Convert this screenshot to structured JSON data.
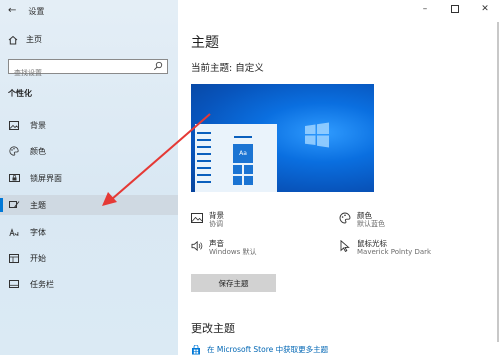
{
  "window": {
    "title": "设置"
  },
  "sidebar": {
    "home_label": "主页",
    "search_placeholder": "查找设置",
    "section_label": "个性化",
    "items": [
      {
        "label": "背景",
        "icon": "image-icon"
      },
      {
        "label": "颜色",
        "icon": "palette-icon"
      },
      {
        "label": "锁屏界面",
        "icon": "lock-screen-icon"
      },
      {
        "label": "主题",
        "icon": "theme-brush-icon",
        "active": true
      },
      {
        "label": "字体",
        "icon": "font-icon"
      },
      {
        "label": "开始",
        "icon": "start-icon"
      },
      {
        "label": "任务栏",
        "icon": "taskbar-icon"
      }
    ]
  },
  "main": {
    "title": "主题",
    "current_theme": "当前主题: 自定义",
    "preview_sample": "Aa",
    "options": [
      {
        "title": "背景",
        "subtitle": "协调",
        "icon": "background-image-icon"
      },
      {
        "title": "颜色",
        "subtitle": "默认蓝色",
        "icon": "color-palette-icon"
      },
      {
        "title": "声音",
        "subtitle": "Windows 默认",
        "icon": "speaker-icon"
      },
      {
        "title": "鼠标光标",
        "subtitle": "Maverick Polnty Dark",
        "icon": "mouse-cursor-icon"
      }
    ],
    "save_button": "保存主题",
    "change_heading": "更改主题",
    "store_link": "在 Microsoft Store 中获取更多主题"
  },
  "colors": {
    "accent": "#0078d7",
    "arrow": "#e53935",
    "sidebar_bg": "#e4eef6"
  }
}
